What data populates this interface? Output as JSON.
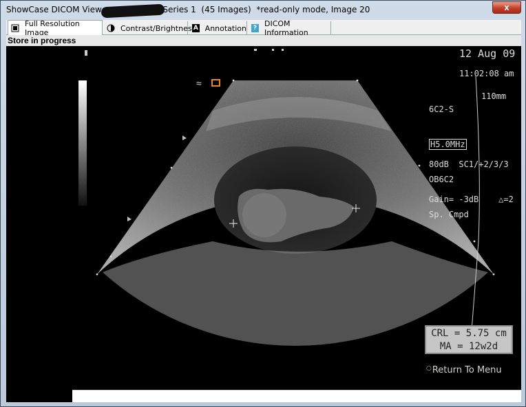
{
  "window": {
    "title_prefix": "ShowCase DICOM Viewer",
    "title_suffix": "Series 1  (45 Images)  *read-only mode, Image 20",
    "close_label": "x"
  },
  "tabs": [
    {
      "label": "Full Resolution Image",
      "icon": "image-icon"
    },
    {
      "label": "Contrast/Brightness",
      "icon": "contrast-icon"
    },
    {
      "label": "Annotation",
      "icon": "annotation-icon"
    },
    {
      "label": "DICOM Information",
      "icon": "info-icon"
    }
  ],
  "overlay": {
    "date": "12 Aug 09",
    "time": "11:02:08 am",
    "probe": "6C2-S",
    "frequency": "H5.0MHz",
    "depth": "110mm",
    "preset": "OB6C2",
    "mode": "Sp. Cmpd",
    "dynamic_range": "80dB  SC1/+2/3/3",
    "gain": "Gain= -3dB    △=2",
    "status": "Store in progress"
  },
  "measurements": {
    "crl": "CRL = 5.75 cm",
    "ma": "MA = 12w2d"
  },
  "nav": {
    "return_label": "Return To Menu"
  }
}
